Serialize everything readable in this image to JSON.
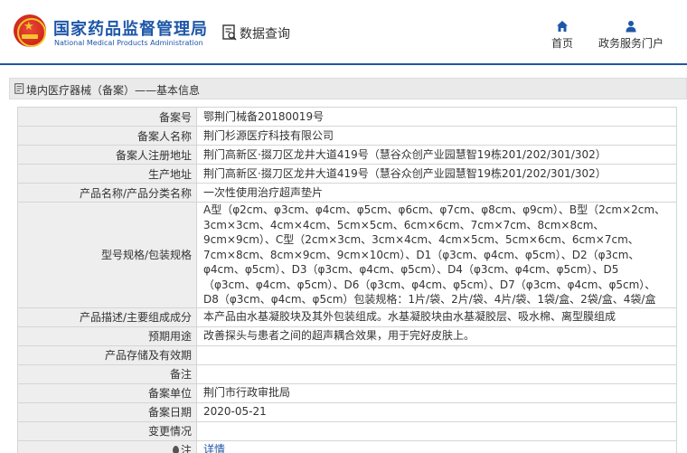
{
  "header": {
    "site_name_cn": "国家药品监督管理局",
    "site_name_en": "National Medical Products Administration",
    "query_label": "数据查询",
    "nav": [
      {
        "label": "首页",
        "icon": "home-icon"
      },
      {
        "label": "政务服务门户",
        "icon": "user-icon"
      }
    ],
    "accent_color": "#1e57a8"
  },
  "breadcrumb": {
    "text": "境内医疗器械（备案）——基本信息",
    "icon": "document-icon"
  },
  "record": {
    "rows": [
      {
        "label": "备案号",
        "value": "鄂荆门械备20180019号"
      },
      {
        "label": "备案人名称",
        "value": "荆门杉源医疗科技有限公司"
      },
      {
        "label": "备案人注册地址",
        "value": "荆门高新区·掇刀区龙井大道419号（慧谷众创产业园慧智19栋201/202/301/302）"
      },
      {
        "label": "生产地址",
        "value": "荆门高新区·掇刀区龙井大道419号（慧谷众创产业园慧智19栋201/202/301/302）"
      },
      {
        "label": "产品名称/产品分类名称",
        "value": "一次性使用治疗超声垫片"
      },
      {
        "label": "型号规格/包装规格",
        "value": "A型（φ2cm、φ3cm、φ4cm、φ5cm、φ6cm、φ7cm、φ8cm、φ9cm）、B型（2cm×2cm、3cm×3cm、4cm×4cm、5cm×5cm、6cm×6cm、7cm×7cm、8cm×8cm、9cm×9cm）、C型（2cm×3cm、3cm×4cm、4cm×5cm、5cm×6cm、6cm×7cm、7cm×8cm、8cm×9cm、9cm×10cm）、D1（φ3cm、φ4cm、φ5cm）、D2（φ3cm、φ4cm、φ5cm）、D3（φ3cm、φ4cm、φ5cm）、D4（φ3cm、φ4cm、φ5cm）、D5（φ3cm、φ4cm、φ5cm）、D6（φ3cm、φ4cm、φ5cm）、D7（φ3cm、φ4cm、φ5cm）、D8（φ3cm、φ4cm、φ5cm）包装规格：1片/袋、2片/袋、4片/袋、1袋/盒、2袋/盒、4袋/盒"
      },
      {
        "label": "产品描述/主要组成成分",
        "value": "本产品由水基凝胶块及其外包装组成。水基凝胶块由水基凝胶层、吸水棉、离型膜组成"
      },
      {
        "label": "预期用途",
        "value": "改善探头与患者之间的超声耦合效果，用于完好皮肤上。"
      },
      {
        "label": "产品存储及有效期",
        "value": ""
      },
      {
        "label": "备注",
        "value": ""
      },
      {
        "label": "备案单位",
        "value": "荆门市行政审批局"
      },
      {
        "label": "备案日期",
        "value": "2020-05-21"
      },
      {
        "label": "变更情况",
        "value": ""
      }
    ],
    "note_label": "注",
    "note_link": "详情"
  }
}
